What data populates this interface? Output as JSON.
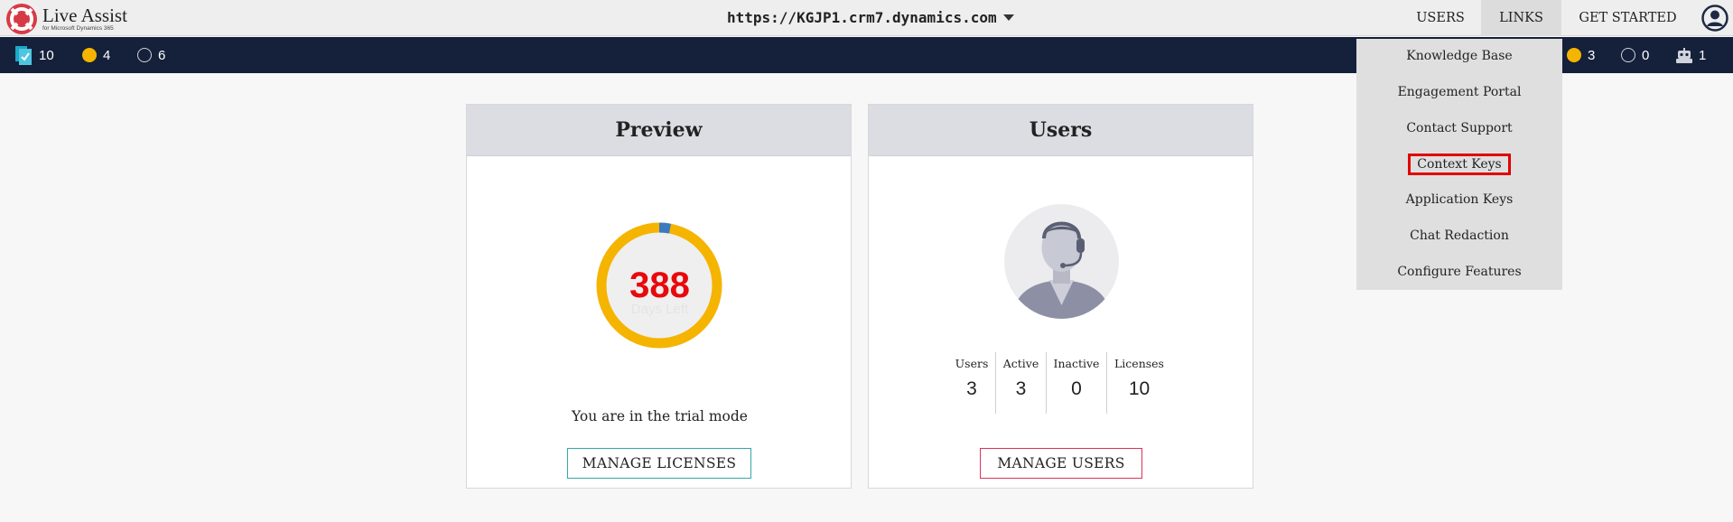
{
  "header": {
    "brand_title": "Live Assist",
    "brand_subtitle": "for Microsoft Dynamics 365",
    "url": "https://KGJP1.crm7.dynamics.com",
    "nav": {
      "users": "USERS",
      "links": "LINKS",
      "get_started": "GET STARTED"
    }
  },
  "statusbar": {
    "left": {
      "agents": "10",
      "busy": "4",
      "offline": "6"
    },
    "right": {
      "busy": "3",
      "offline": "0",
      "bots": "1"
    }
  },
  "links_menu": {
    "items": [
      "Knowledge Base",
      "Engagement Portal",
      "Contact Support",
      "Context Keys",
      "Application Keys",
      "Chat Redaction",
      "Configure Features"
    ],
    "highlighted": "Context Keys"
  },
  "preview_card": {
    "title": "Preview",
    "days_left": "388",
    "days_label": "Days Left",
    "trial_text": "You are in the trial mode",
    "manage_button": "MANAGE LICENSES",
    "ring_elapsed_fraction": 0.03
  },
  "users_card": {
    "title": "Users",
    "stats": [
      {
        "label": "Users",
        "value": "3"
      },
      {
        "label": "Active",
        "value": "3"
      },
      {
        "label": "Inactive",
        "value": "0"
      },
      {
        "label": "Licenses",
        "value": "10"
      }
    ],
    "manage_button": "MANAGE USERS"
  },
  "colors": {
    "navbar": "#15203a",
    "ring": "#f5b400",
    "ring_elapsed": "#3a7bbf",
    "days_number": "#e8090c",
    "menu_highlight": "#e00000"
  }
}
